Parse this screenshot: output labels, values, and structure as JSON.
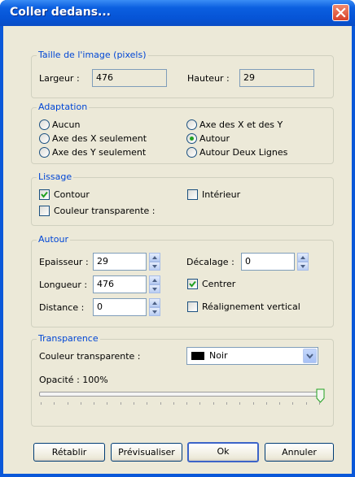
{
  "window": {
    "title": "Coller dedans..."
  },
  "image_size": {
    "legend": "Taille de l'image (pixels)",
    "width_label": "Largeur :",
    "width_value": "476",
    "height_label": "Hauteur :",
    "height_value": "29"
  },
  "adaptation": {
    "legend": "Adaptation",
    "options": [
      "Aucun",
      "Axe des X seulement",
      "Axe des Y seulement",
      "Axe des X et des Y",
      "Autour",
      "Autour Deux Lignes"
    ],
    "selected": "Autour"
  },
  "lissage": {
    "legend": "Lissage",
    "contour_label": "Contour",
    "contour_checked": true,
    "interieur_label": "Intérieur",
    "interieur_checked": false,
    "transparent_label": "Couleur transparente :",
    "transparent_checked": false
  },
  "autour": {
    "legend": "Autour",
    "epaisseur_label": "Epaisseur :",
    "epaisseur_value": "29",
    "longueur_label": "Longueur :",
    "longueur_value": "476",
    "distance_label": "Distance :",
    "distance_value": "0",
    "decalage_label": "Décalage :",
    "decalage_value": "0",
    "centrer_label": "Centrer",
    "centrer_checked": true,
    "realign_label": "Réalignement vertical",
    "realign_checked": false
  },
  "transparence": {
    "legend": "Transparence",
    "color_label": "Couleur transparente :",
    "color_value": "Noir",
    "color_swatch": "#000000",
    "opacity_label": "Opacité : 100%",
    "opacity_fraction": 1.0
  },
  "buttons": {
    "reset": "Rétablir",
    "preview": "Prévisualiser",
    "ok": "Ok",
    "cancel": "Annuler"
  },
  "colors": {
    "titlebar": "#0654d6",
    "group_label": "#0046d5",
    "face": "#ece9d8"
  }
}
